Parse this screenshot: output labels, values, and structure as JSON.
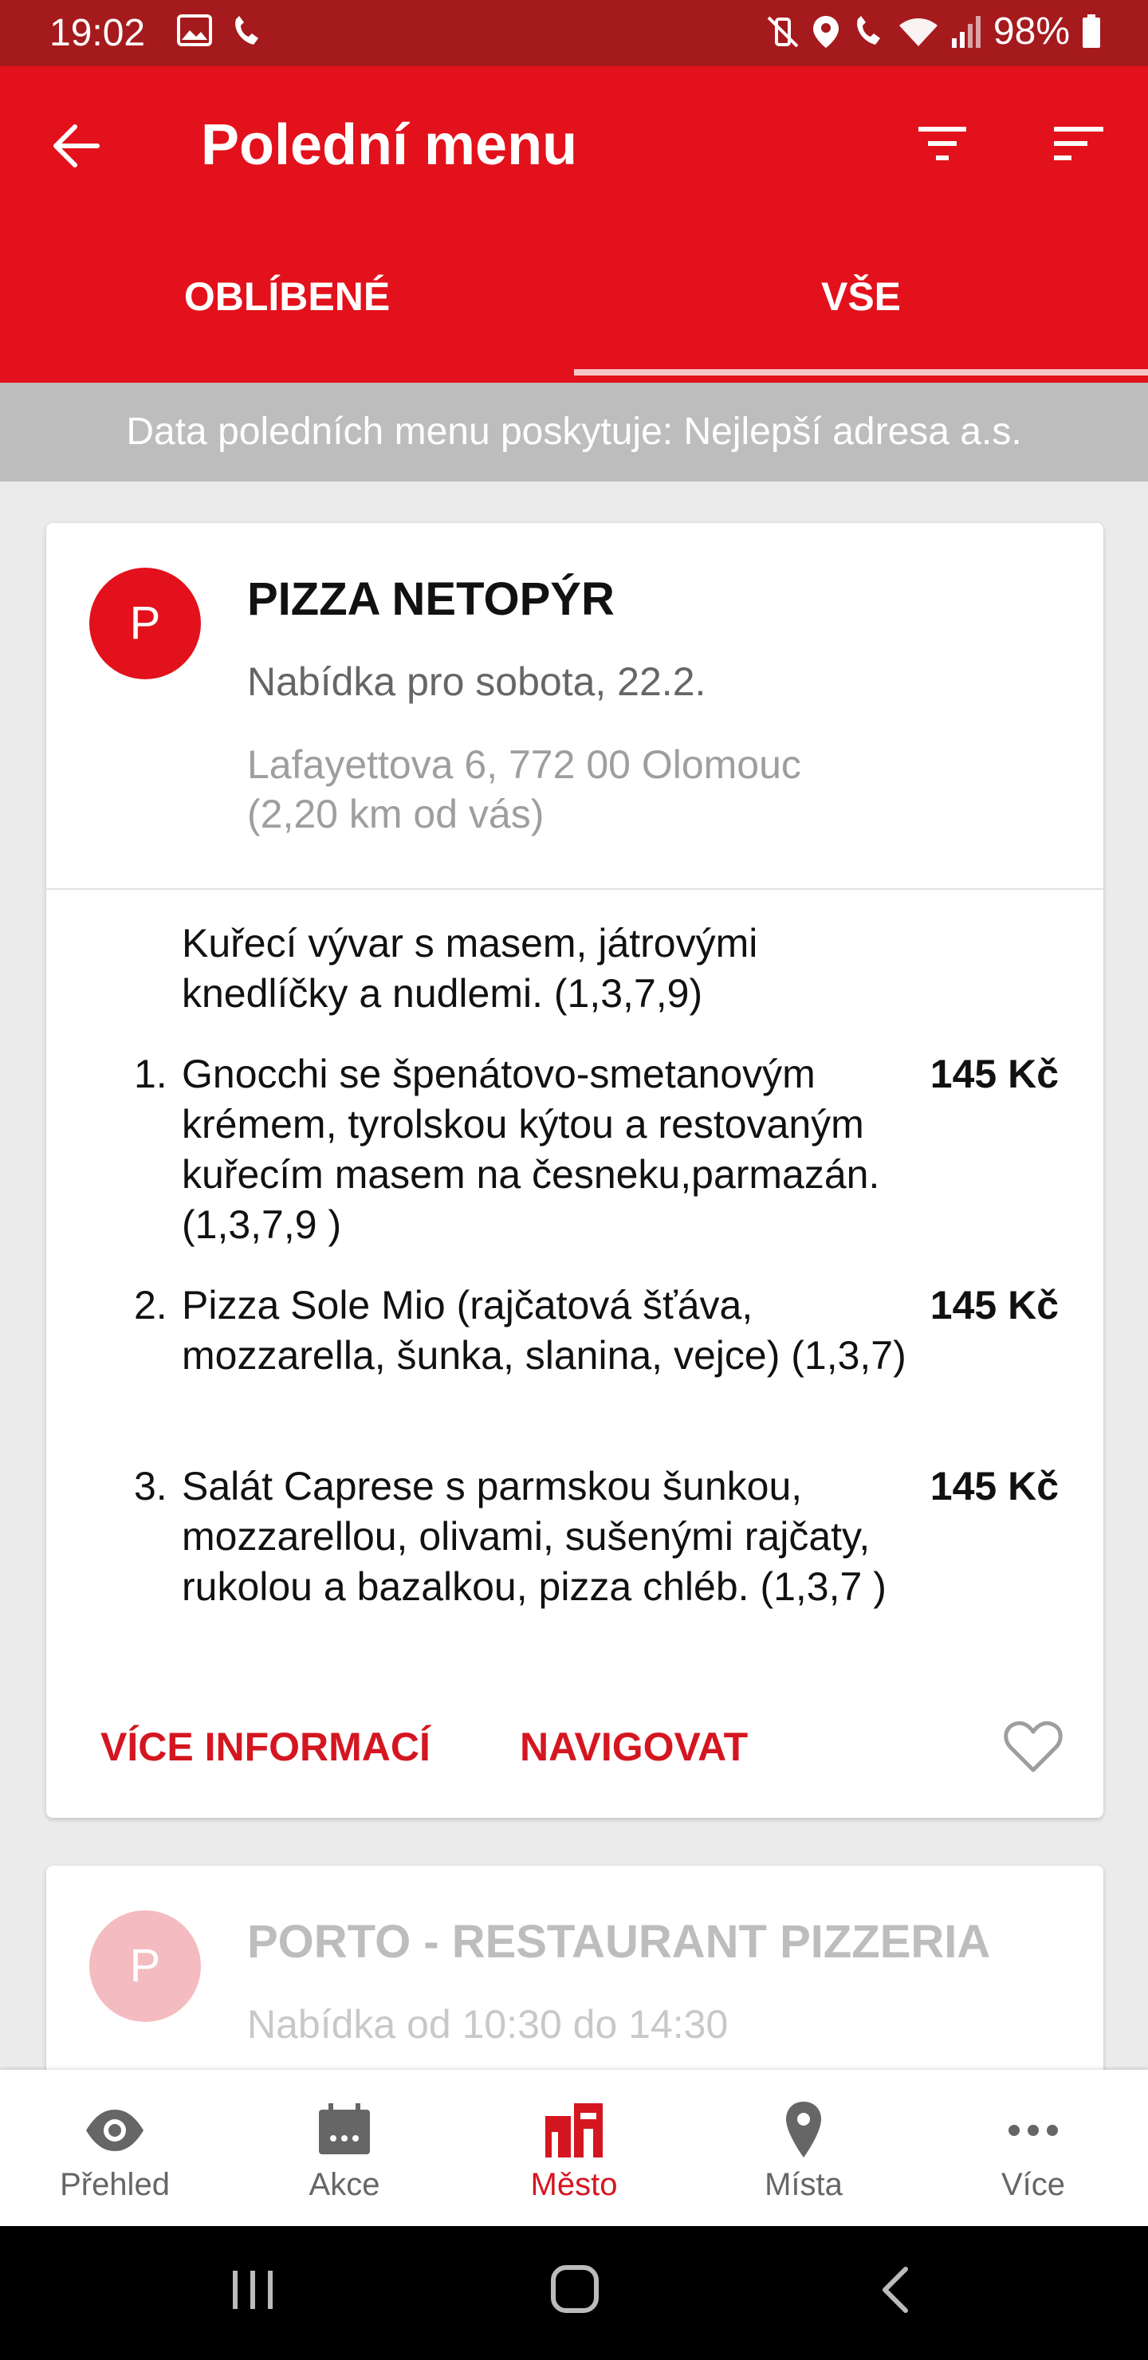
{
  "status_bar": {
    "time": "19:02",
    "battery": "98%"
  },
  "app_bar": {
    "title": "Polední menu",
    "tabs": [
      "OBLÍBENÉ",
      "VŠE"
    ],
    "active_tab": "VŠE"
  },
  "info_bar": {
    "text": "Data poledních menu poskytuje: Nejlepší adresa a.s."
  },
  "restaurants": [
    {
      "avatar_letter": "P",
      "name": "PIZZA NETOPÝR",
      "offer": "Nabídka pro sobota, 22.2.",
      "address_line1": "Lafayettova 6, 772 00  Olomouc",
      "address_line2": "(2,20 km od vás)",
      "soup": "Kuřecí vývar s masem, játrovými knedlíčky a nudlemi. (1,3,7,9)",
      "items": [
        {
          "num": "1.",
          "text": "Gnocchi se špenátovo-smetanovým krémem, tyrolskou kýtou a restovaným kuřecím masem na česneku,parmazán. (1,3,7,9 )",
          "price": "145 Kč"
        },
        {
          "num": "2.",
          "text": "Pizza Sole Mio (rajčatová šťáva, mozzarella, šunka, slanina, vejce) (1,3,7)",
          "price": "145 Kč"
        },
        {
          "num": "3.",
          "text": "Salát Caprese s parmskou šunkou, mozzarellou, olivami, sušenými rajčaty, rukolou a bazalkou, pizza chléb. (1,3,7 )",
          "price": "145 Kč"
        }
      ],
      "actions": {
        "more_info": "VÍCE INFORMACÍ",
        "navigate": "NAVIGOVAT"
      }
    },
    {
      "avatar_letter": "P",
      "name": "PORTO - RESTAURANT PIZZERIA",
      "offer": "Nabídka od 10:30 do 14:30"
    }
  ],
  "bottom_nav": [
    {
      "label": "Přehled",
      "icon": "eye-icon"
    },
    {
      "label": "Akce",
      "icon": "calendar-icon"
    },
    {
      "label": "Město",
      "icon": "city-icon",
      "active": true
    },
    {
      "label": "Místa",
      "icon": "location-pin-icon"
    },
    {
      "label": "Více",
      "icon": "more-dots-icon"
    }
  ],
  "colors": {
    "primary": "#e3111b",
    "status_bar": "#a41a1d",
    "accent_text": "#d41620"
  }
}
